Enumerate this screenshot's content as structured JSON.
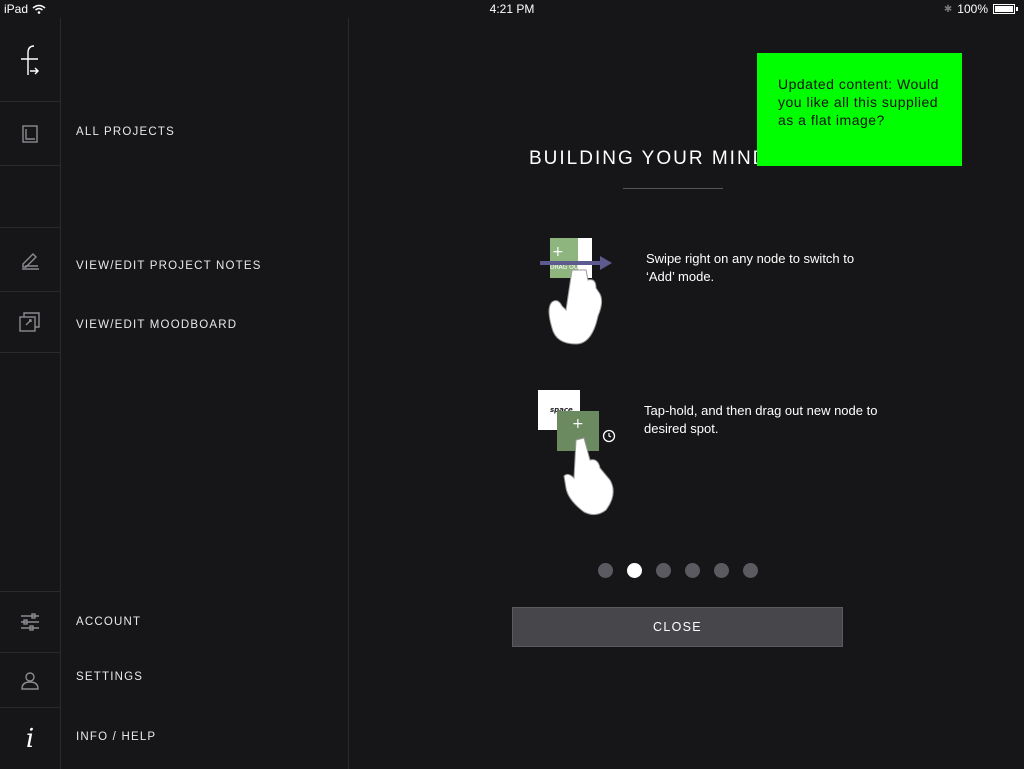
{
  "status_bar": {
    "device": "iPad",
    "time": "4:21 PM",
    "battery": "100%"
  },
  "menu": {
    "all_projects": "ALL PROJECTS",
    "project_notes": "VIEW/EDIT PROJECT NOTES",
    "moodboard": "VIEW/EDIT MOODBOARD",
    "account": "ACCOUNT",
    "settings": "SETTINGS",
    "info_help": "INFO / HELP"
  },
  "rail_icons": [
    "logo-icon",
    "projects-icon",
    "notes-icon",
    "moodboard-icon",
    "account-icon",
    "user-icon",
    "info-icon"
  ],
  "help": {
    "title": "BUILDING YOUR MIND MAP",
    "step1": {
      "text": "Swipe right on any node to switch to ‘Add’ mode.",
      "node_label": "DRAG OUT"
    },
    "step2": {
      "text": "Tap-hold, and then drag out new node to desired spot.",
      "node_label": "space"
    },
    "pager": {
      "count": 6,
      "current": 2
    },
    "close_label": "CLOSE"
  },
  "note": {
    "text": "Updated content: Would you like all this supplied as a flat image?",
    "color": "#00ff00"
  }
}
